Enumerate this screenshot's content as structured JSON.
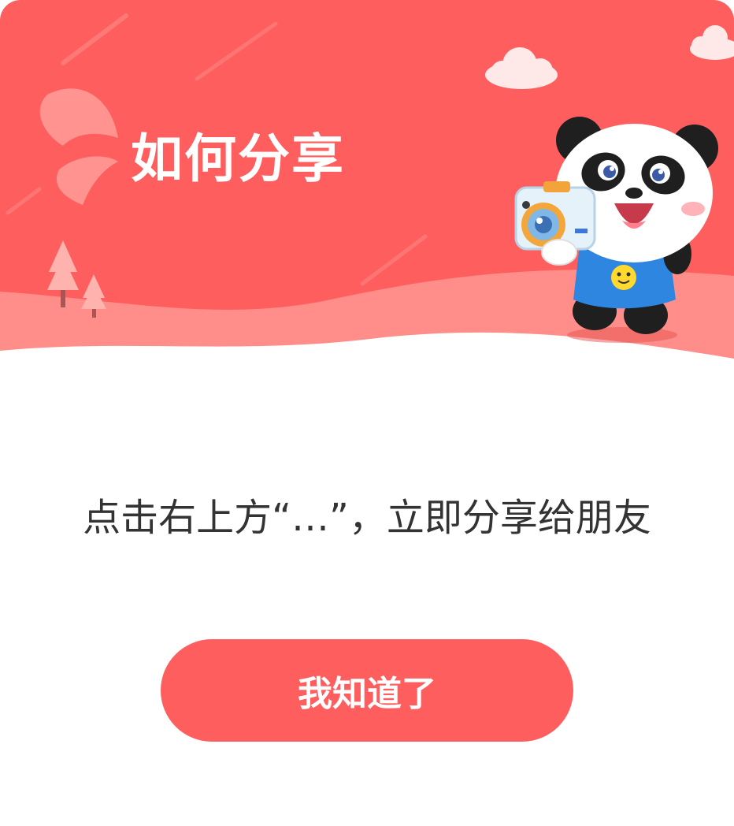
{
  "dialog": {
    "title": "如何分享",
    "message": "点击右上方“…”，立即分享给朋友",
    "confirm_label": "我知道了"
  },
  "illustration": {
    "subject": "panda-with-camera",
    "decorations": [
      "cloud-icon",
      "tree-icon",
      "sparkle-shape"
    ]
  },
  "colors": {
    "header_red": "#fe5f5e",
    "wave_pink": "#ff8e8a",
    "button_red": "#fe5f5e",
    "text_dark": "#333333",
    "white": "#ffffff"
  }
}
